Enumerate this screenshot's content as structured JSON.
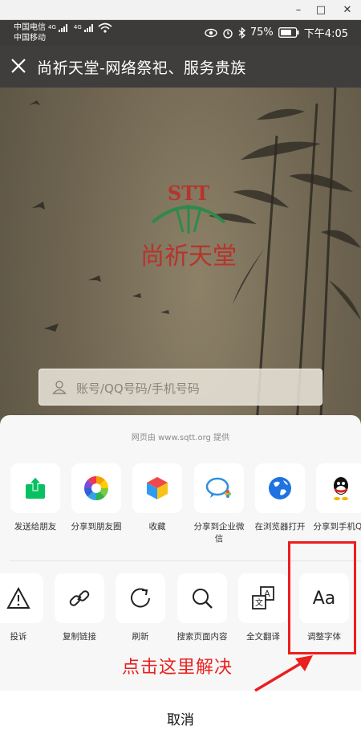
{
  "window": {
    "minimize_glyph": "–",
    "maximize_glyph": "□",
    "close_glyph": "✕"
  },
  "status_bar": {
    "carrier_1": "中国电信",
    "carrier_2": "中国移动",
    "network_1": "4G",
    "network_2": "4G",
    "battery_percent": "75%",
    "time": "下午4:05"
  },
  "title_bar": {
    "title": "尚祈天堂-网络祭祀、服务贵族"
  },
  "webpage": {
    "logo_acronym": "STT",
    "logo_text": "尚祈天堂",
    "login_placeholder": "账号/QQ号码/手机号码"
  },
  "share_sheet": {
    "provider_text": "网页由 www.sqtt.org 提供",
    "row1": [
      {
        "label": "发送给朋友",
        "icon": "send-to-friend-icon"
      },
      {
        "label": "分享到朋友圈",
        "icon": "moments-icon"
      },
      {
        "label": "收藏",
        "icon": "favorites-icon"
      },
      {
        "label": "分享到企业微信",
        "icon": "work-wechat-icon"
      },
      {
        "label": "在浏览器打开",
        "icon": "browser-icon"
      },
      {
        "label": "分享到手机QQ",
        "icon": "qq-icon"
      }
    ],
    "row2": [
      {
        "label": "投诉",
        "icon": "warning-icon"
      },
      {
        "label": "复制链接",
        "icon": "link-icon"
      },
      {
        "label": "刷新",
        "icon": "refresh-icon"
      },
      {
        "label": "搜索页面内容",
        "icon": "search-icon"
      },
      {
        "label": "全文翻译",
        "icon": "translate-icon"
      },
      {
        "label": "调整字体",
        "icon": "font-size-icon"
      }
    ],
    "font_icon_text": "Aa",
    "cancel_label": "取消"
  },
  "annotation": {
    "hint_text": "点击这里解决",
    "color": "#e8201f"
  },
  "colors": {
    "titlebar_bg": "#3f3e3c",
    "sheet_bg": "#f7f7f7",
    "wechat_green": "#07c160"
  }
}
